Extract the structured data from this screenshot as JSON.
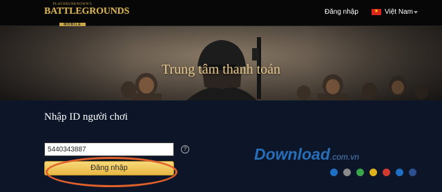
{
  "header": {
    "logo": {
      "line1": "PLAYERUNKNOWN'S",
      "line2": "BATTLEGROUNDS",
      "line3": "MOBILE"
    },
    "login_link": "Đăng nhập",
    "language": {
      "label": "Việt Nam",
      "flag_color": "#da251d"
    }
  },
  "banner": {
    "title": "Trung tâm thanh toán"
  },
  "form": {
    "title": "Nhập ID người chơi",
    "player_id_value": "5440343887",
    "help_symbol": "?",
    "submit_label": "Đăng nhập"
  },
  "watermark": {
    "text": "Download",
    "domain": ".com.vn",
    "dot_colors": [
      "#1f6fc4",
      "#8a8a8a",
      "#3aa64a",
      "#e0b21c",
      "#d13a2f",
      "#1f6fc4",
      "#2c4f8f"
    ]
  }
}
